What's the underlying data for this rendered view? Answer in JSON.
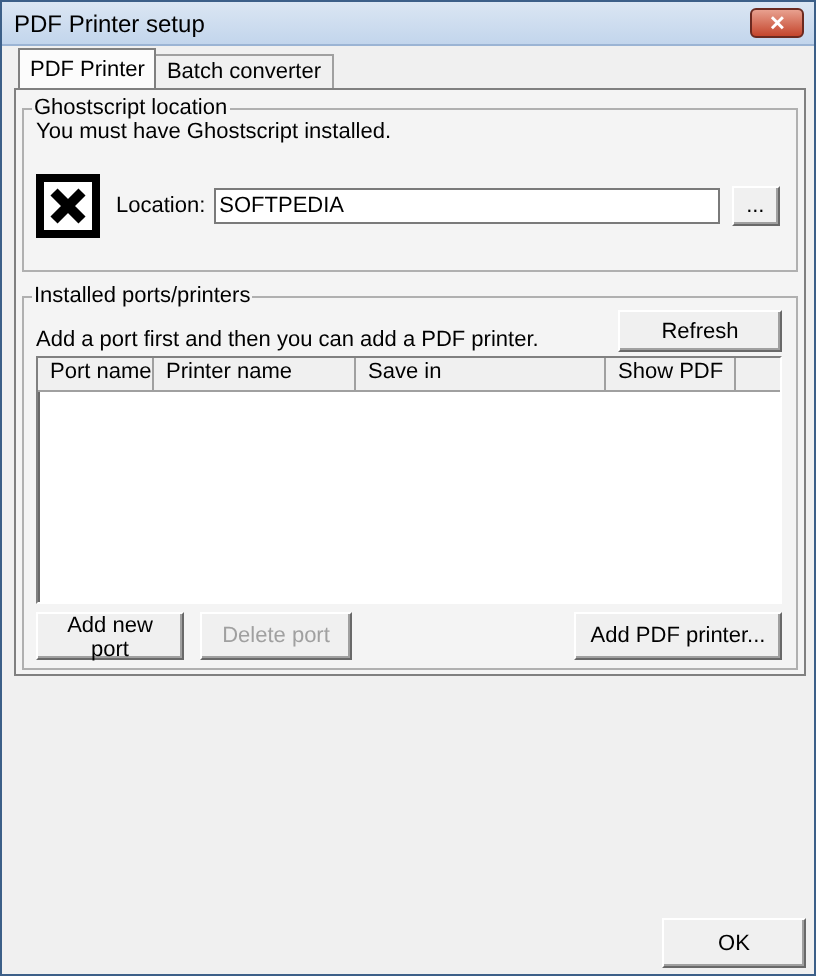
{
  "window": {
    "title": "PDF Printer setup",
    "close": "✕"
  },
  "tabs": [
    {
      "label": "PDF Printer",
      "selected": true
    },
    {
      "label": "Batch converter",
      "selected": false
    }
  ],
  "ghostscript": {
    "legend": "Ghostscript location",
    "message": "You must have Ghostscript installed.",
    "location_label": "Location:",
    "location_value": "SOFTPEDIA",
    "browse_button": "..."
  },
  "ports": {
    "legend": "Installed ports/printers",
    "message": "Add a port first and then you can add a PDF printer.",
    "refresh_button": "Refresh",
    "columns": [
      "Port name",
      "Printer name",
      "Save in",
      "Show PDF"
    ],
    "buttons": [
      {
        "label": "Add new port",
        "disabled": false
      },
      {
        "label": "Delete port",
        "disabled": true
      },
      {
        "label": "Add PDF printer...",
        "disabled": false
      }
    ]
  },
  "ok_button": "OK"
}
